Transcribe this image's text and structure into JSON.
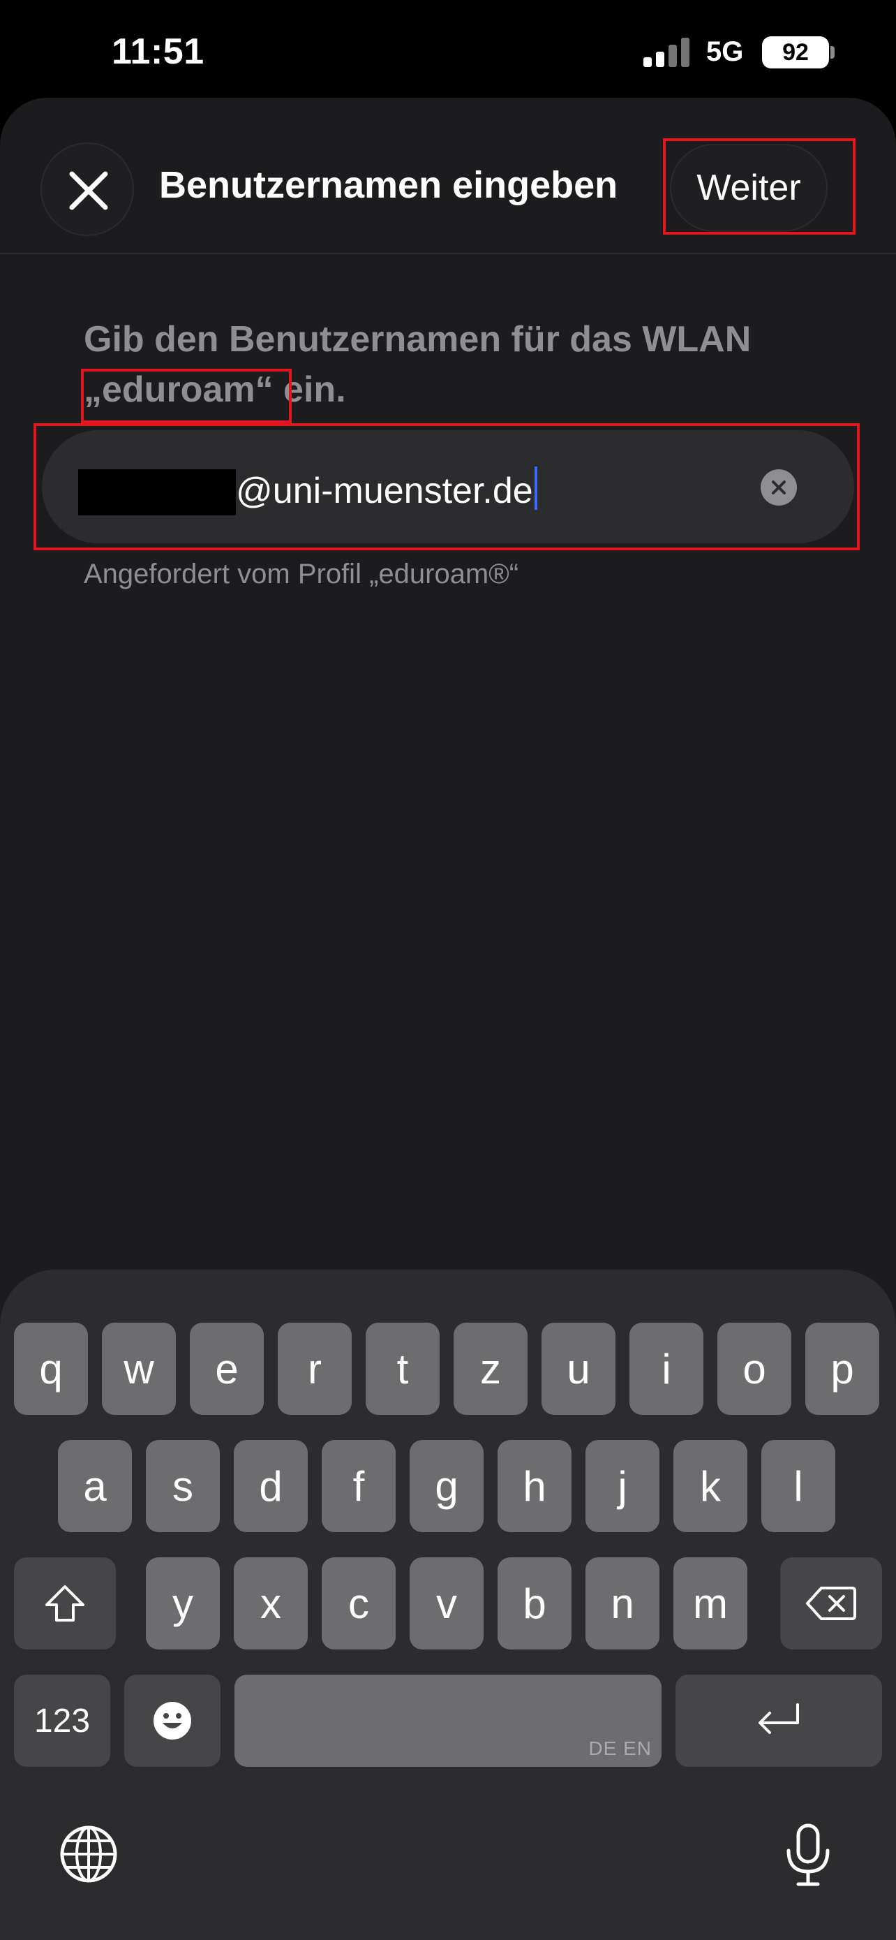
{
  "status_bar": {
    "time": "11:51",
    "network": "5G",
    "battery": "92"
  },
  "sheet": {
    "title": "Benutzernamen eingeben",
    "next_label": "Weiter",
    "prompt_text": "Gib den Benutzernamen für das WLAN",
    "prompt_network": "„eduroam“",
    "prompt_end": " ein.",
    "username_value": "@uni-muenster.de",
    "subtext": "Angefordert vom Profil „eduroam®“"
  },
  "keyboard": {
    "row1": [
      "q",
      "w",
      "e",
      "r",
      "t",
      "z",
      "u",
      "i",
      "o",
      "p"
    ],
    "row2": [
      "a",
      "s",
      "d",
      "f",
      "g",
      "h",
      "j",
      "k",
      "l"
    ],
    "row3": [
      "y",
      "x",
      "c",
      "v",
      "b",
      "n",
      "m"
    ],
    "numbers_label": "123",
    "space_lang": "DE EN"
  },
  "colors": {
    "highlight": "#e3151f",
    "caret": "#3b6cff",
    "sheet_bg": "#1c1c1e",
    "key_bg": "#6d6d70"
  }
}
